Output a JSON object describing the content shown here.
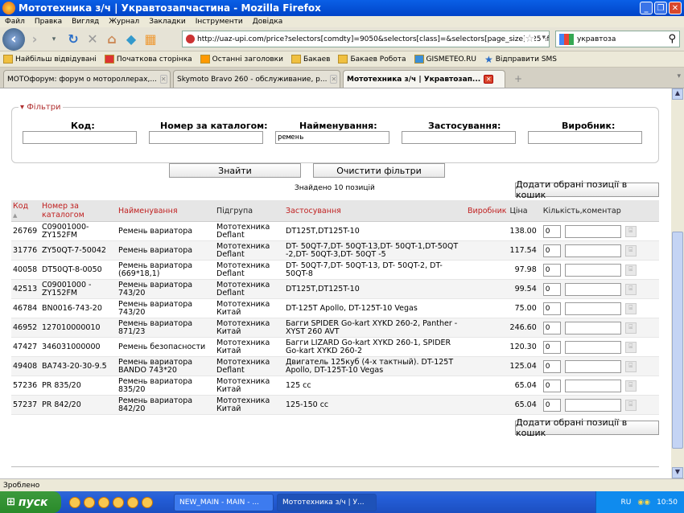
{
  "window": {
    "title": "Мототехника з/ч | Укравтозапчастина - Mozilla Firefox"
  },
  "menu": [
    "Файл",
    "Правка",
    "Вигляд",
    "Журнал",
    "Закладки",
    "Інструменти",
    "Довідка"
  ],
  "nav": {
    "url": "http://uaz-upi.com/price?selectors[comdty]=9050&selectors[class]=&selectors[page_size]=25&filter",
    "search_engine": "укравтоза"
  },
  "bookmarks": [
    "Найбільш відвідувані",
    "Початкова сторінка",
    "Останні заголовки",
    "Бакаев",
    "Бакаев Робота",
    "GISMETEO.RU",
    "Відправити SMS"
  ],
  "tabs": [
    "МОТОфорум: форум о мотороллерах,...",
    "Skymoto Bravo 260 - обслуживание, р...",
    "Мототехника з/ч | Укравтозап..."
  ],
  "filters": {
    "legend": "▾ Фільтри",
    "code_label": "Код:",
    "catalog_label": "Номер за каталогом:",
    "name_label": "Найменування:",
    "application_label": "Застосування:",
    "maker_label": "Виробник:",
    "name_value": "ремень"
  },
  "buttons": {
    "find": "Знайти",
    "clear": "Очистити фільтри",
    "add_to_cart": "Додати обрані позиції в кошик"
  },
  "found_text": "Знайдено 10 позицій",
  "table": {
    "headers": {
      "code": "Код",
      "catalog": "Номер за каталогом",
      "name": "Найменування",
      "subgroup": "Підгрупа",
      "application": "Застосування",
      "maker": "Виробник",
      "price": "Ціна",
      "qty": "Кількість,коментар"
    },
    "rows": [
      {
        "code": "26769",
        "catalog": "C09001000-ZY152FM",
        "name": "Ремень вариатора",
        "subgroup": "Мототехника Deflant",
        "application": "DT125T,DT125T-10",
        "price": "138.00",
        "qty": "0"
      },
      {
        "code": "31776",
        "catalog": "ZY50QT-7-50042",
        "name": "Ремень вариатора",
        "subgroup": "Мототехника Deflant",
        "application": "DT- 50QT-7,DT- 50QT-13,DT- 50QT-1,DT-50QT -2,DT- 50QT-3,DT- 50QT -5",
        "price": "117.54",
        "qty": "0"
      },
      {
        "code": "40058",
        "catalog": "DT50QT-8-0050",
        "name": "Ремень вариатора (669*18,1)",
        "subgroup": "Мототехника Deflant",
        "application": "DT- 50QT-7,DT- 50QT-13, DT- 50QT-2, DT-50QT-8",
        "price": "97.98",
        "qty": "0"
      },
      {
        "code": "42513",
        "catalog": "C09001000 -ZY152FM",
        "name": "Ремень вариатора 743/20",
        "subgroup": "Мототехника Deflant",
        "application": "DT125T,DT125T-10",
        "price": "99.54",
        "qty": "0"
      },
      {
        "code": "46784",
        "catalog": "BN0016-743-20",
        "name": "Ремень вариатора 743/20",
        "subgroup": "Мототехника Китай",
        "application": "DT-125T Apollo, DT-125T-10 Vegas",
        "price": "75.00",
        "qty": "0"
      },
      {
        "code": "46952",
        "catalog": "127010000010",
        "name": "Ремень вариатора 871/23",
        "subgroup": "Мототехника Китай",
        "application": "Багги SPIDER Go-kart XYKD 260-2, Panther - XYST 260 AVT",
        "price": "246.60",
        "qty": "0"
      },
      {
        "code": "47427",
        "catalog": "346031000000",
        "name": "Ремень безопасности",
        "subgroup": "Мототехника Китай",
        "application": "Багги LIZARD Go-kart XYKD 260-1, SPIDER Go-kart XYKD 260-2",
        "price": "120.30",
        "qty": "0"
      },
      {
        "code": "49408",
        "catalog": "BA743-20-30-9.5",
        "name": "Ремень вариатора BANDO 743*20",
        "subgroup": "Мототехника Deflant",
        "application": "Двигатель 125куб (4-х тактный). DT-125T Apollo, DT-125T-10 Vegas",
        "price": "125.04",
        "qty": "0"
      },
      {
        "code": "57236",
        "catalog": "PR 835/20",
        "name": "Ремень вариатора 835/20",
        "subgroup": "Мототехника Китай",
        "application": "125 cc",
        "price": "65.04",
        "qty": "0"
      },
      {
        "code": "57237",
        "catalog": "PR 842/20",
        "name": "Ремень вариатора 842/20",
        "subgroup": "Мототехника Китай",
        "application": "125-150 cc",
        "price": "65.04",
        "qty": "0"
      }
    ]
  },
  "status": "Зроблено",
  "taskbar": {
    "start": "пуск",
    "items": [
      "NEW_MAIN - MAIN - ...",
      "Мототехника з/ч | У..."
    ],
    "lang": "RU",
    "time": "10:50"
  }
}
